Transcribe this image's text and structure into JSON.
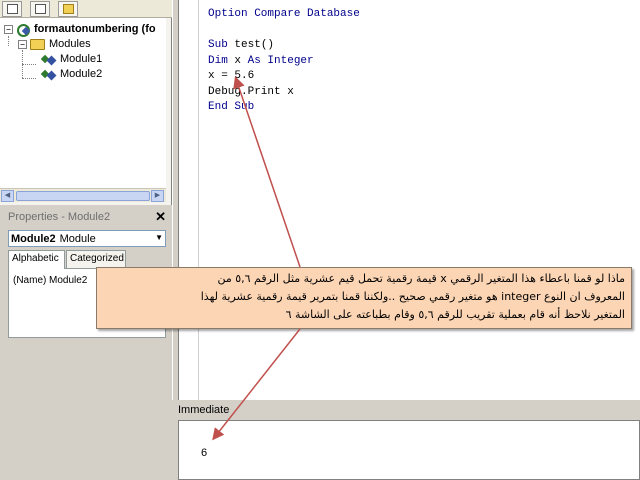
{
  "project": {
    "root": "formautonumbering (fo",
    "folder": "Modules",
    "modules": [
      "Module1",
      "Module2"
    ]
  },
  "properties": {
    "title": "Properties - Module2",
    "object_name": "Module2",
    "object_type": "Module",
    "tabs": [
      "Alphabetic",
      "Categorized"
    ],
    "row_name": "(Name)",
    "row_value": "Module2"
  },
  "code": {
    "lines": [
      {
        "kw": "Option Compare Database",
        "text": ""
      },
      {
        "kw": "",
        "text": ""
      },
      {
        "kw": "Sub",
        "text": " test()"
      },
      {
        "kw": "Dim",
        "text": " x "
      },
      {
        "kw": "",
        "text": "x = 5.6"
      },
      {
        "kw": "",
        "text": "Debug.Print x"
      },
      {
        "kw": "End Sub",
        "text": ""
      }
    ],
    "dim_as": "As Integer"
  },
  "immediate": {
    "title": "Immediate",
    "output": "6"
  },
  "callout": {
    "line1": "ماذا لو قمنا باعطاء هذا المتغير الرقمي x قيمة رقمية تحمل قيم عشرية مثل الرقم ٥,٦ من",
    "line2": "المعروف ان النوع integer هو متغير رقمي صحيح ..ولكننا قمنا بتمرير قيمة رقمية عشرية لهذا",
    "line3": "المتغير نلاحظ أنه قام بعملية تقريب للرقم ٥,٦ وقام بطباعته على الشاشة ٦"
  },
  "colors": {
    "keyword": "#00008b",
    "callout_bg": "#fcd5b4",
    "arrow": "#c0504d"
  }
}
